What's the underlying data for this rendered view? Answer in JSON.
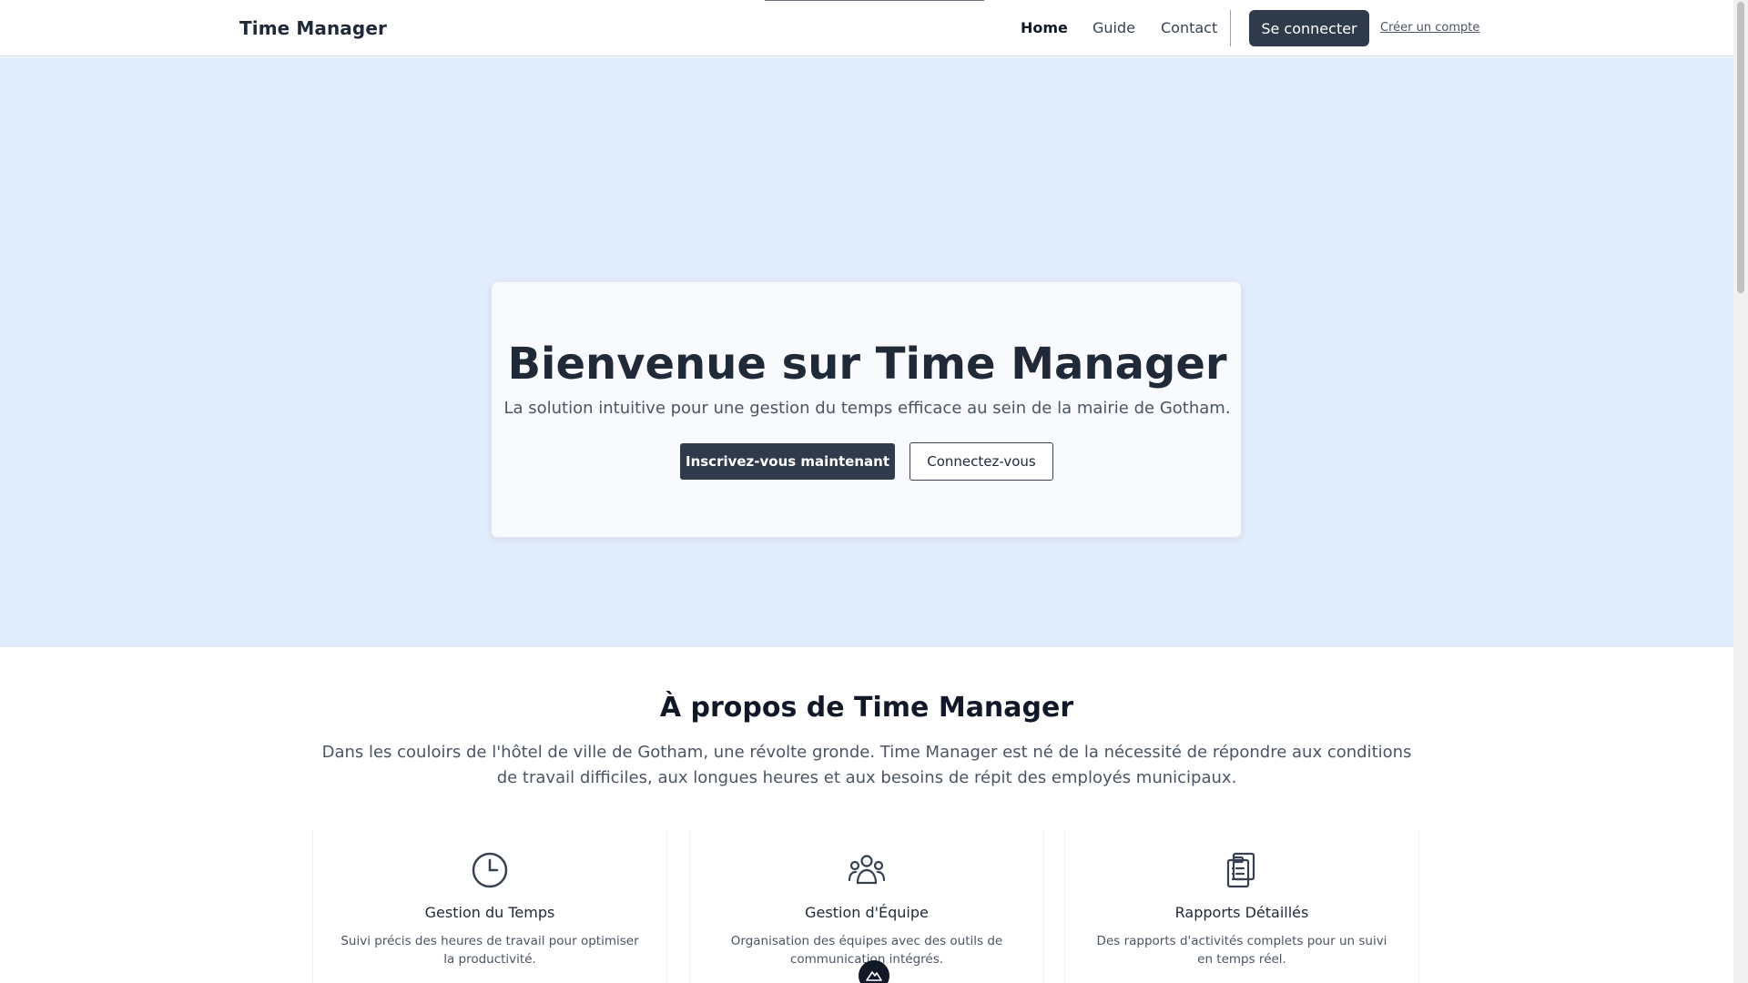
{
  "header": {
    "brand": "Time Manager",
    "nav": {
      "home": "Home",
      "guide": "Guide",
      "contact": "Contact"
    },
    "login_button": "Se connecter",
    "create_account_link": "Créer un compte"
  },
  "hero": {
    "title": "Bienvenue sur Time Manager",
    "subtitle": "La solution intuitive pour une gestion du temps efficace au sein de la mairie de Gotham.",
    "signup_button": "Inscrivez-vous maintenant",
    "connect_button": "Connectez-vous"
  },
  "about": {
    "title": "À propos de Time Manager",
    "text": "Dans les couloirs de l'hôtel de ville de Gotham, une révolte gronde. Time Manager est né de la nécessité de répondre aux conditions de travail difficiles, aux longues heures et aux besoins de répit des employés municipaux."
  },
  "features": [
    {
      "icon": "clock-icon",
      "title": "Gestion du Temps",
      "description": "Suivi précis des heures de travail pour optimiser la productivité."
    },
    {
      "icon": "team-icon",
      "title": "Gestion d'Équipe",
      "description": "Organisation des équipes avec des outils de communication intégrés."
    },
    {
      "icon": "clipboard-report-icon",
      "title": "Rapports Détaillés",
      "description": "Des rapports d'activités complets pour un suivi en temps réel."
    }
  ],
  "colors": {
    "hero_background": "#e1edfd",
    "primary_button": "#2f3a4b",
    "text_dark": "#1f2937"
  }
}
